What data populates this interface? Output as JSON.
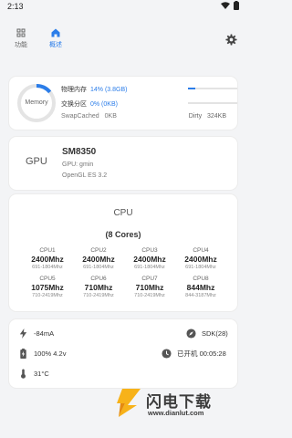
{
  "status_bar": {
    "time": "2:13"
  },
  "tabs": [
    {
      "label": "功能",
      "icon": "grid-icon",
      "active": false
    },
    {
      "label": "概述",
      "icon": "home-icon",
      "active": true
    }
  ],
  "colors": {
    "accent": "#2b7de9",
    "card": "#ffffff",
    "background": "#f3f4f6"
  },
  "memory": {
    "ring_label": "Memory",
    "ram_label": "物理内存",
    "ram_value": "14% (3.8GB)",
    "ram_percent": 14,
    "swap_label": "交换分区",
    "swap_value": "0% (0KB)",
    "swap_percent": 0,
    "swapcached_label": "SwapCached",
    "swapcached_value": "0KB",
    "dirty_label": "Dirty",
    "dirty_value": "324KB"
  },
  "gpu": {
    "label": "GPU",
    "model": "SM8350",
    "vendor": "GPU: gmin",
    "opengl": "OpenGL ES 3.2"
  },
  "cpu": {
    "title": "CPU",
    "cores_label": "(8 Cores)",
    "cores": [
      {
        "name": "CPU1",
        "freq": "2400Mhz",
        "range": "691-1804Mhz"
      },
      {
        "name": "CPU2",
        "freq": "2400Mhz",
        "range": "691-1804Mhz"
      },
      {
        "name": "CPU3",
        "freq": "2400Mhz",
        "range": "691-1804Mhz"
      },
      {
        "name": "CPU4",
        "freq": "2400Mhz",
        "range": "691-1804Mhz"
      },
      {
        "name": "CPU5",
        "freq": "1075Mhz",
        "range": "710-2419Mhz"
      },
      {
        "name": "CPU6",
        "freq": "710Mhz",
        "range": "710-2419Mhz"
      },
      {
        "name": "CPU7",
        "freq": "710Mhz",
        "range": "710-2419Mhz"
      },
      {
        "name": "CPU8",
        "freq": "844Mhz",
        "range": "844-3187Mhz"
      }
    ]
  },
  "stats": {
    "current": "-84mA",
    "sdk": "SDK(28)",
    "battery": "100% 4.2v",
    "uptime": "已开机 00:05:28",
    "temperature": "31°C"
  },
  "watermark": {
    "text": "闪电下载",
    "url": "www.dianlut.com"
  }
}
